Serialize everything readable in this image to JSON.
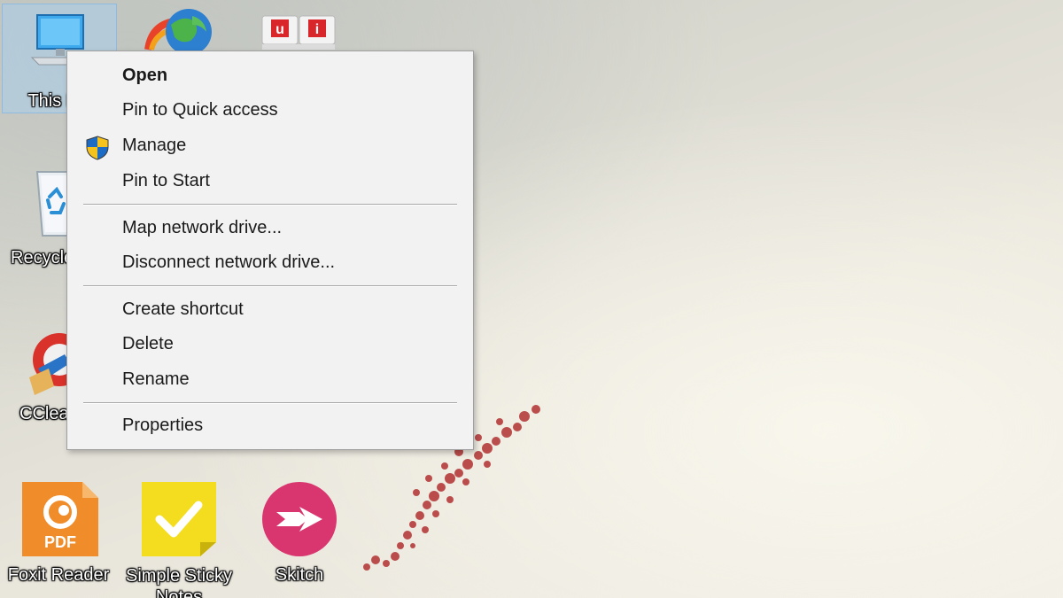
{
  "desktop": {
    "icons": [
      {
        "label": "This PC",
        "icon": "computer-icon"
      },
      {
        "label": "",
        "icon": "download-manager-icon"
      },
      {
        "label": "",
        "icon": "unikey-icon",
        "glyph_letters": [
          "u",
          "i"
        ]
      },
      {
        "label": "Recycle Bin",
        "icon": "recycle-bin-icon"
      },
      {
        "label": "CCleaner",
        "icon": "ccleaner-icon"
      },
      {
        "label": "Foxit Reader",
        "icon": "foxit-reader-icon",
        "badge": "PDF"
      },
      {
        "label": "Simple Sticky Notes",
        "icon": "sticky-notes-icon"
      },
      {
        "label": "Skitch",
        "icon": "skitch-icon"
      }
    ]
  },
  "context_menu": {
    "items": [
      {
        "label": "Open",
        "bold": true
      },
      {
        "label": "Pin to Quick access"
      },
      {
        "label": "Manage",
        "icon": "uac-shield-icon"
      },
      {
        "label": "Pin to Start"
      },
      {
        "label": "Map network drive..."
      },
      {
        "label": "Disconnect network drive..."
      },
      {
        "label": "Create shortcut"
      },
      {
        "label": "Delete"
      },
      {
        "label": "Rename"
      },
      {
        "label": "Properties"
      }
    ]
  },
  "colors": {
    "menu_background": "#f2f2f2",
    "menu_border": "#a0a0a0",
    "selection": "#aacdeb",
    "foxit_orange": "#f08c2a",
    "sticky_yellow": "#f4dc1e",
    "skitch_pink": "#d9356e",
    "shield_blue": "#1c6bc4",
    "shield_yellow": "#f6c21c"
  }
}
